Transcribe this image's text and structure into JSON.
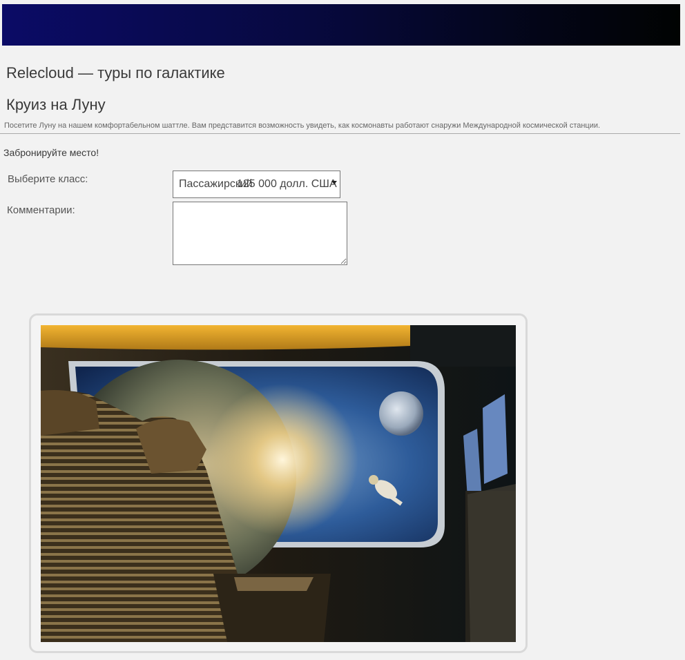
{
  "header": {
    "site_title": "Relecloud — туры по галактике"
  },
  "tour": {
    "title": "Круиз на Луну",
    "description": "Посетите Луну на нашем комфортабельном шаттле. Вам представится возможность увидеть, как космонавты работают снаружи Международной космической станции."
  },
  "booking": {
    "heading": "Забронируйте место!",
    "class_label": "Выберите класс:",
    "class_selected_name": "Пассажирский",
    "class_selected_price": "125 000 долл. США",
    "comments_label": "Комментарии:",
    "comments_value": ""
  },
  "colors": {
    "banner_start": "#0b0b66",
    "banner_end": "#010302",
    "page_background": "#f2f2f2"
  }
}
